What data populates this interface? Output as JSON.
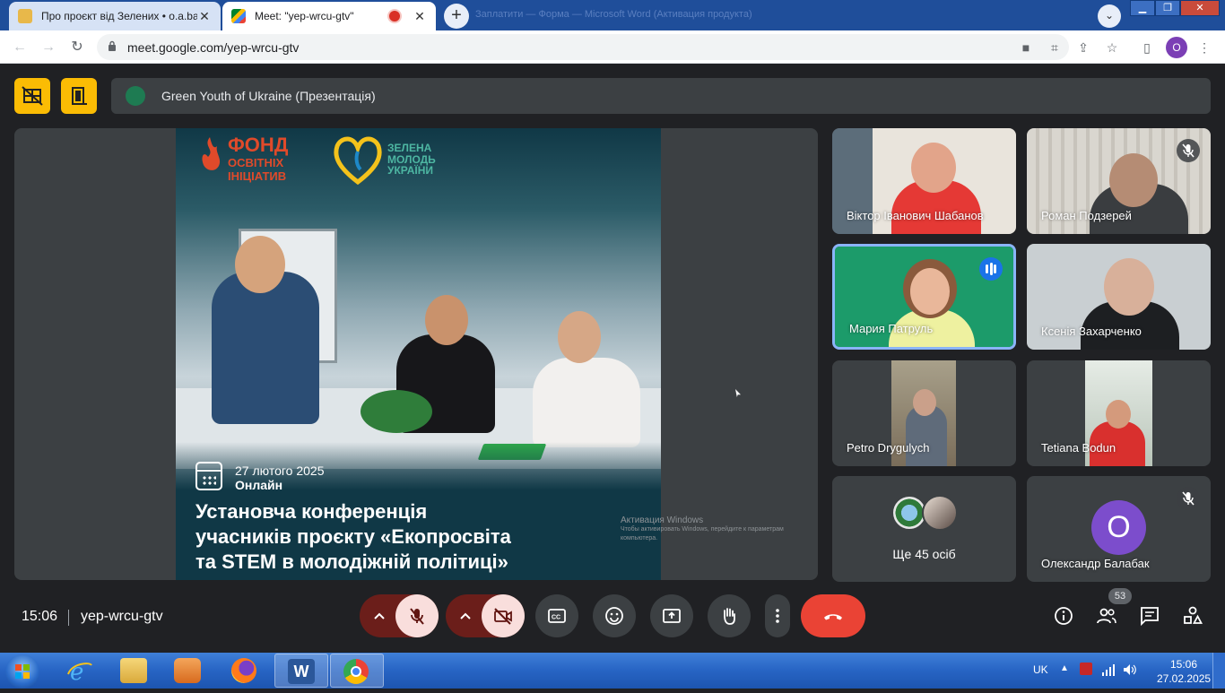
{
  "browser": {
    "tabs": [
      {
        "title": "Про проєкт від Зелених • о.а.ba",
        "close": "✕"
      },
      {
        "title": "Meet: \"yep-wrcu-gtv\"",
        "close": "✕"
      }
    ],
    "new_tab": "+",
    "background_title": "Заплатити — Форма — Microsoft Word (Активация продукта)",
    "window_controls": {
      "minimize": "▁",
      "maximize": "❐",
      "close": "✕"
    },
    "url": "meet.google.com/yep-wrcu-gtv",
    "profile_initial": "O"
  },
  "meet": {
    "presentation_title": "Green Youth of Ukraine (Презентація)",
    "slide": {
      "org1_line1": "ФОНД",
      "org1_line2": "ОСВІТНІХ",
      "org1_line3": "ІНІЦІАТИВ",
      "org2_line1": "ЗЕЛЕНА",
      "org2_line2": "МОЛОДЬ",
      "org2_line3": "УКРАЇНИ",
      "date": "27 лютого 2025",
      "format": "Онлайн",
      "headline_1": "Установча конференція",
      "headline_2": "учасників проєкту «Екопросвіта",
      "headline_3": "та STEM в молодіжній політиці»"
    },
    "watermark": {
      "line1": "Активация Windows",
      "line2": "Чтобы активировать Windows, перейдите к параметрам",
      "line3": "компьютера."
    },
    "participants": [
      {
        "name": "Віктор Іванович Шабанов"
      },
      {
        "name": "Роман Подзерей"
      },
      {
        "name": "Мария Патруль"
      },
      {
        "name": "Ксенія Захарченко"
      },
      {
        "name": "Petro Drygulych"
      },
      {
        "name": "Tetiana Bodun"
      },
      {
        "name": "Олександр Балабак",
        "initial": "O"
      }
    ],
    "others_label": "Ще 45 осіб",
    "time": "15:06",
    "meeting_code": "yep-wrcu-gtv",
    "participant_count": "53"
  },
  "taskbar": {
    "language": "UK",
    "time": "15:06",
    "date": "27.02.2025"
  },
  "colors": {
    "meet_bg": "#202124",
    "tile_bg": "#3c4043",
    "accent_yellow": "#fbbc04",
    "end_call_red": "#ea4335",
    "active_speaker": "#8ab4f8"
  }
}
